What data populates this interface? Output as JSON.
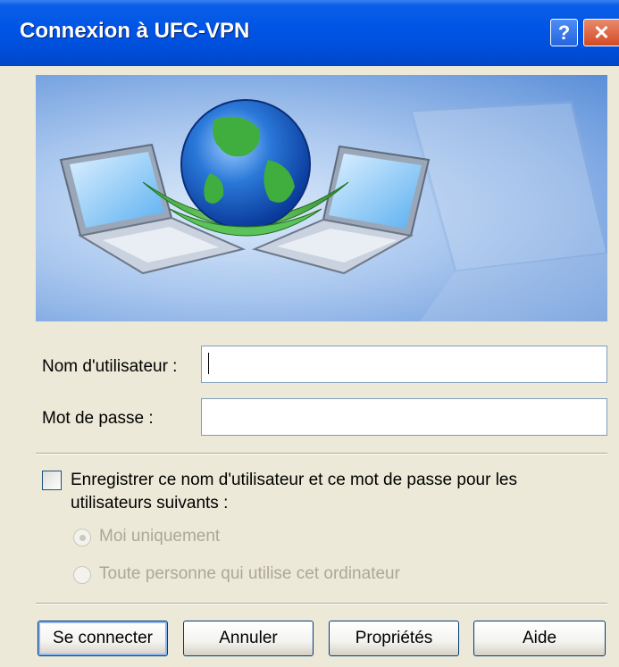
{
  "window": {
    "title": "Connexion à UFC-VPN",
    "help_glyph": "?",
    "close_glyph": "✕"
  },
  "form": {
    "username_label": "Nom d'utilisateur :",
    "username_value": "",
    "password_label": "Mot de passe :",
    "password_value": ""
  },
  "save_credentials": {
    "label": "Enregistrer ce nom d'utilisateur et ce mot de passe pour les utilisateurs suivants :",
    "checked": false,
    "options": [
      {
        "label": "Moi uniquement",
        "selected": true,
        "enabled": false
      },
      {
        "label": "Toute personne qui utilise cet ordinateur",
        "selected": false,
        "enabled": false
      }
    ]
  },
  "buttons": {
    "connect": "Se connecter",
    "cancel": "Annuler",
    "properties": "Propriétés",
    "help": "Aide"
  },
  "colors": {
    "titlebar": "#0055E5",
    "dialog_bg": "#ECE9D8",
    "disabled_text": "#ACA899"
  },
  "icons": {
    "banner": "network-connection-globe-laptops"
  }
}
